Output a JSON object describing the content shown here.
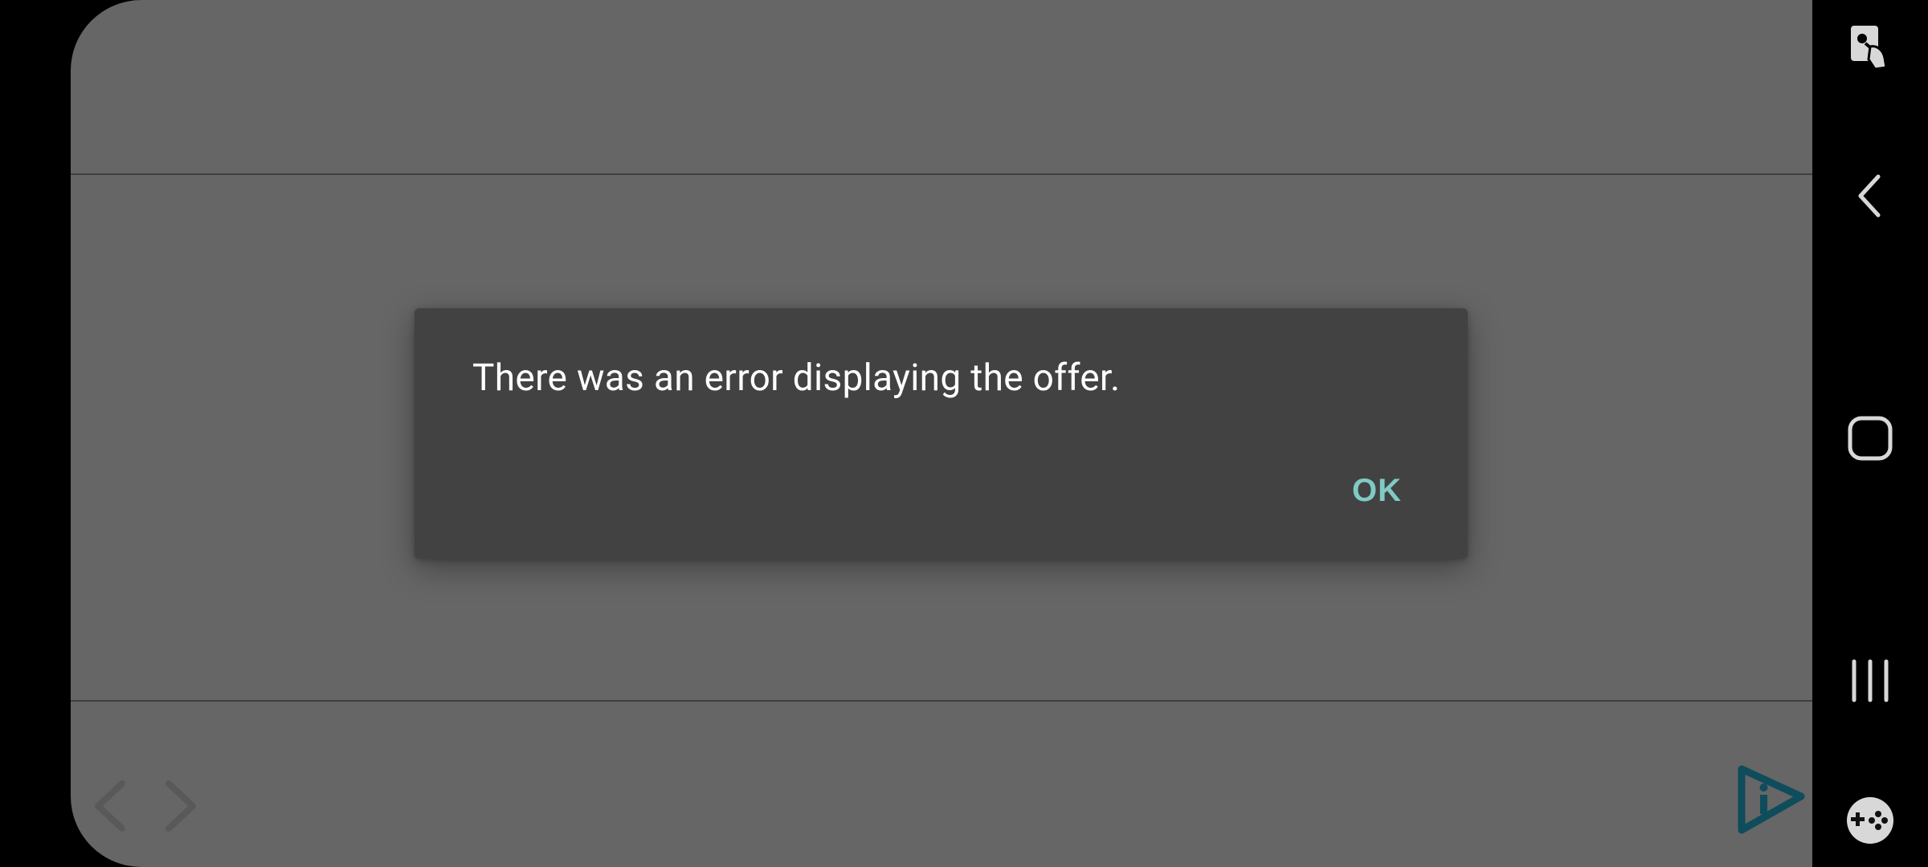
{
  "dialog": {
    "message": "There was an error displaying the offer.",
    "ok_label": "OK"
  },
  "colors": {
    "accent": "#7fcbc4",
    "dialog_background": "#424242",
    "app_overlay": "#666666",
    "brand": "#0f4c5c"
  },
  "icons": {
    "app_back": "chevron-left-icon",
    "app_forward": "chevron-right-icon",
    "brand": "brand-logo-icon",
    "system_accessibility": "accessibility-touch-icon",
    "system_back": "back-icon",
    "system_home": "home-icon",
    "system_recents": "recents-icon",
    "system_game": "game-launcher-icon"
  }
}
